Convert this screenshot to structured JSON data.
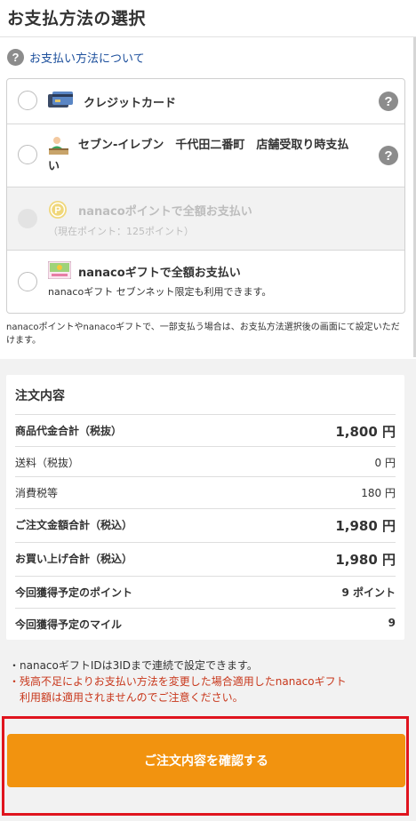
{
  "page": {
    "title": "お支払方法の選択"
  },
  "help_link": {
    "icon": "question-icon",
    "label": "お支払い方法について"
  },
  "payment_options": [
    {
      "id": "credit",
      "label": "クレジットカード",
      "icon": "credit-card-icon",
      "has_help": true,
      "disabled": false
    },
    {
      "id": "store",
      "label_line1": "セブン-イレブン　千代田二番町　店舗受取り時支払",
      "label_line2": "い",
      "icon": "store-clerk-icon",
      "has_help": true,
      "disabled": false
    },
    {
      "id": "nanaco-point",
      "label": "nanacoポイントで全額お支払い",
      "sub": "（現在ポイント：125ポイント）",
      "icon": "nanaco-point-icon",
      "disabled": true
    },
    {
      "id": "nanaco-gift",
      "label": "nanacoギフトで全額お支払い",
      "sub": "nanacoギフト セブンネット限定も利用できます。",
      "icon": "nanaco-gift-icon",
      "disabled": false
    }
  ],
  "help_glyph": "?",
  "note": "nanacoポイントやnanacoギフトで、一部支払う場合は、お支払方法選択後の画面にて設定いただけます。",
  "order_summary": {
    "heading": "注文内容",
    "rows": [
      {
        "label": "商品代金合計（税抜）",
        "value": "1,800 円"
      },
      {
        "label": "送料（税抜）",
        "value": "0 円"
      },
      {
        "label": "消費税等",
        "value": "180 円"
      },
      {
        "label": "ご注文金額合計（税込）",
        "value": "1,980 円"
      },
      {
        "label": "お買い上げ合計（税込）",
        "value": "1,980 円"
      },
      {
        "label": "今回獲得予定のポイント",
        "value": "9 ポイント"
      },
      {
        "label": "今回獲得予定のマイル",
        "value": "9"
      }
    ]
  },
  "notices": [
    "・nanacoギフトIDは3IDまで連続で設定できます。",
    "・残高不足によりお支払い方法を変更した場合適用したnanacoギフト",
    "　利用額は適用されませんのでご注意ください。"
  ],
  "confirm_button": {
    "label": "ご注文内容を確認する"
  },
  "colors": {
    "accent": "#f2930f",
    "link": "#1c4f9c",
    "warning": "#c8371b",
    "highlight_frame": "#e0141e"
  }
}
